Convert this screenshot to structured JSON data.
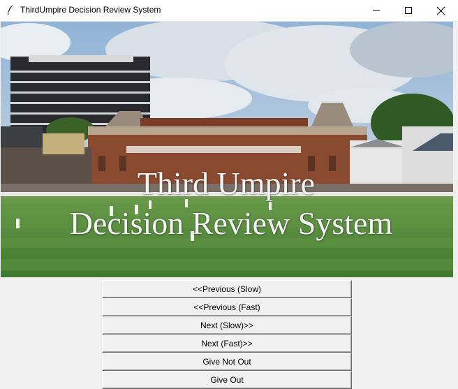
{
  "window": {
    "title": "ThirdUmpire Decision Review System",
    "controls": [
      "minimize-icon",
      "maximize-icon",
      "close-icon"
    ]
  },
  "banner": {
    "line1": "Third Umpire",
    "line2": "Decision Review System"
  },
  "buttons": [
    {
      "label": "<<Previous (Slow)"
    },
    {
      "label": "<<Previous (Fast)"
    },
    {
      "label": "Next (Slow)>>"
    },
    {
      "label": "Next (Fast)>>"
    },
    {
      "label": "Give Not Out"
    },
    {
      "label": "Give Out"
    }
  ],
  "colors": {
    "window_bg": "#f0f0f0",
    "grass": "#4f8a3a",
    "sky": "#a9c3db",
    "brick": "#8a4a2f"
  }
}
